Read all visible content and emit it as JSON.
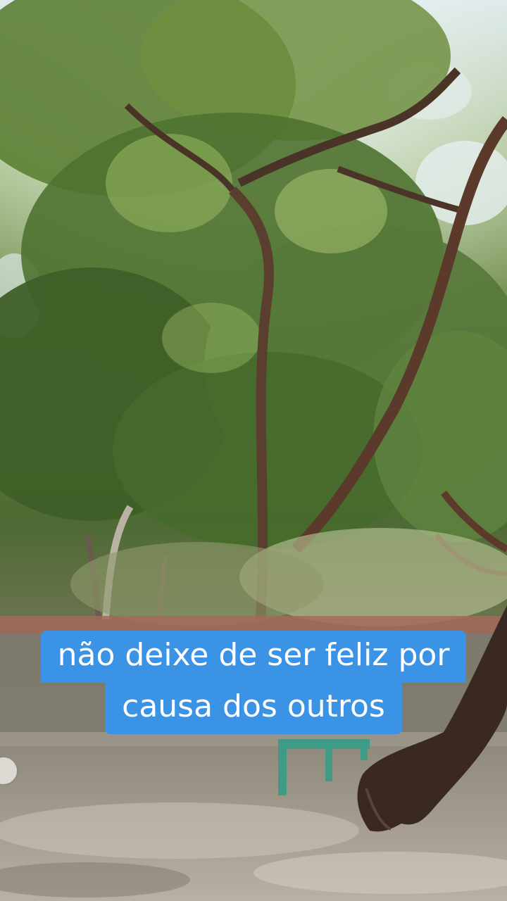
{
  "caption": {
    "line1": "não deixe de ser feliz por",
    "line2": "causa dos outros",
    "background_color": "#3b93e6",
    "text_color": "#ffffff"
  }
}
